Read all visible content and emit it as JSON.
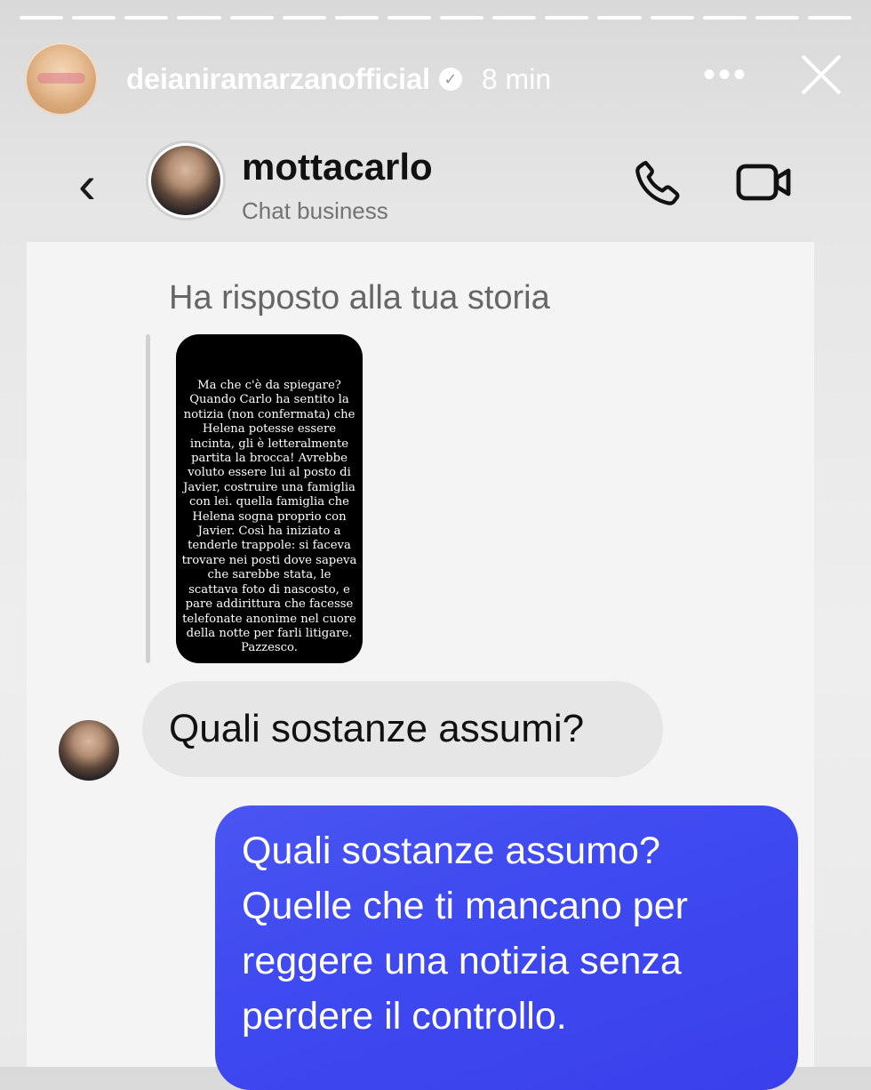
{
  "story": {
    "progress_segments": 16,
    "username": "deianiramarzanofficial",
    "verified": true,
    "time": "8 min",
    "more_icon": "more-horizontal-icon",
    "close_icon": "close-icon"
  },
  "chat": {
    "contact_name": "mottacarlo",
    "subtitle": "Chat business",
    "back_icon": "chevron-left-icon",
    "call_icon": "phone-icon",
    "video_icon": "video-camera-icon"
  },
  "messages": {
    "replied_label": "Ha risposto alla tua storia",
    "story_text": "Ma che c'è da spiegare? Quando Carlo ha sentito la notizia (non confermata) che Helena potesse essere incinta, gli è letteralmente partita la brocca! Avrebbe voluto essere lui al posto di Javier, costruire una famiglia con lei. quella famiglia che Helena sogna proprio con Javier. Così ha iniziato a tenderle trappole: si faceva trovare nei posti dove sapeva che sarebbe stata, le scattava foto di nascosto, e pare addirittura che facesse telefonate anonime nel cuore della notte per farli litigare. Pazzesco.",
    "incoming_text": "Quali sostanze assumi?",
    "outgoing_text": "Quali sostanze assumo? Quelle che ti mancano per reggere una notizia senza perdere il controllo."
  },
  "colors": {
    "outgoing_bubble": "#3f4af0",
    "incoming_bubble": "#e6e6e6"
  }
}
